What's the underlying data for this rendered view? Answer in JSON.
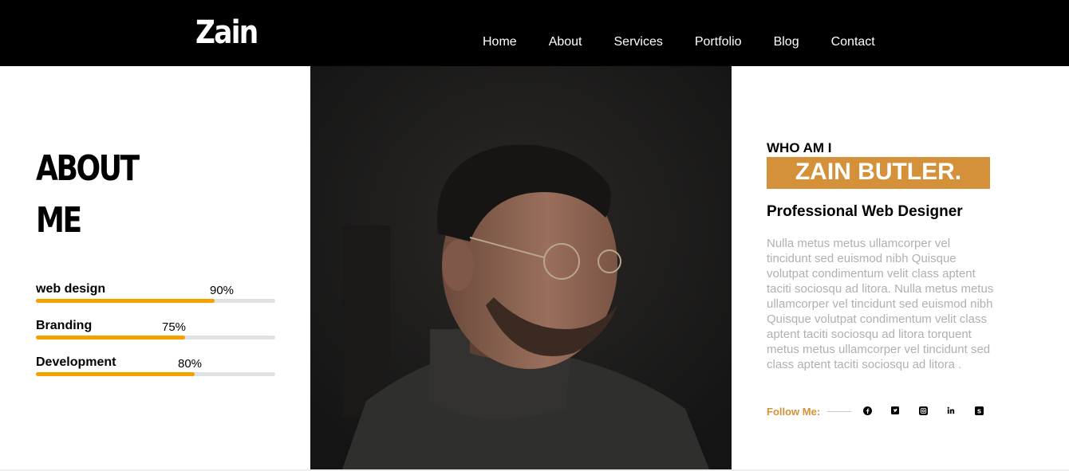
{
  "header": {
    "logo": "Zain",
    "nav": [
      "Home",
      "About",
      "Services",
      "Portfolio",
      "Blog",
      "Contact"
    ]
  },
  "about": {
    "title_line1": "ABOUT",
    "title_line2": "ME",
    "skills": [
      {
        "label": "web design",
        "percent_text": "90%",
        "level": 0.9
      },
      {
        "label": "Branding",
        "percent_text": "75%",
        "level": 0.75
      },
      {
        "label": "Development",
        "percent_text": "80%",
        "level": 0.8
      }
    ]
  },
  "profile": {
    "who": "WHO AM I",
    "name": "ZAIN BUTLER.",
    "role": "Professional Web Designer",
    "description": "Nulla metus metus ullamcorper vel tincidunt sed euismod nibh Quisque volutpat condimentum velit class aptent taciti sociosqu ad litora. Nulla metus metus ullamcorper vel tincidunt sed euismod nibh Quisque volutpat condimentum velit class aptent taciti sociosqu ad litora torquent metus metus ullamcorper vel tincidunt sed class aptent taciti sociosqu ad litora .",
    "follow_label": "Follow Me:",
    "social_icons": [
      "facebook-icon",
      "twitter-icon",
      "instagram-icon",
      "linkedin-icon",
      "skype-icon"
    ]
  },
  "colors": {
    "accent": "#d4913a",
    "progress": "#f5a100",
    "header_bg": "#000000"
  }
}
